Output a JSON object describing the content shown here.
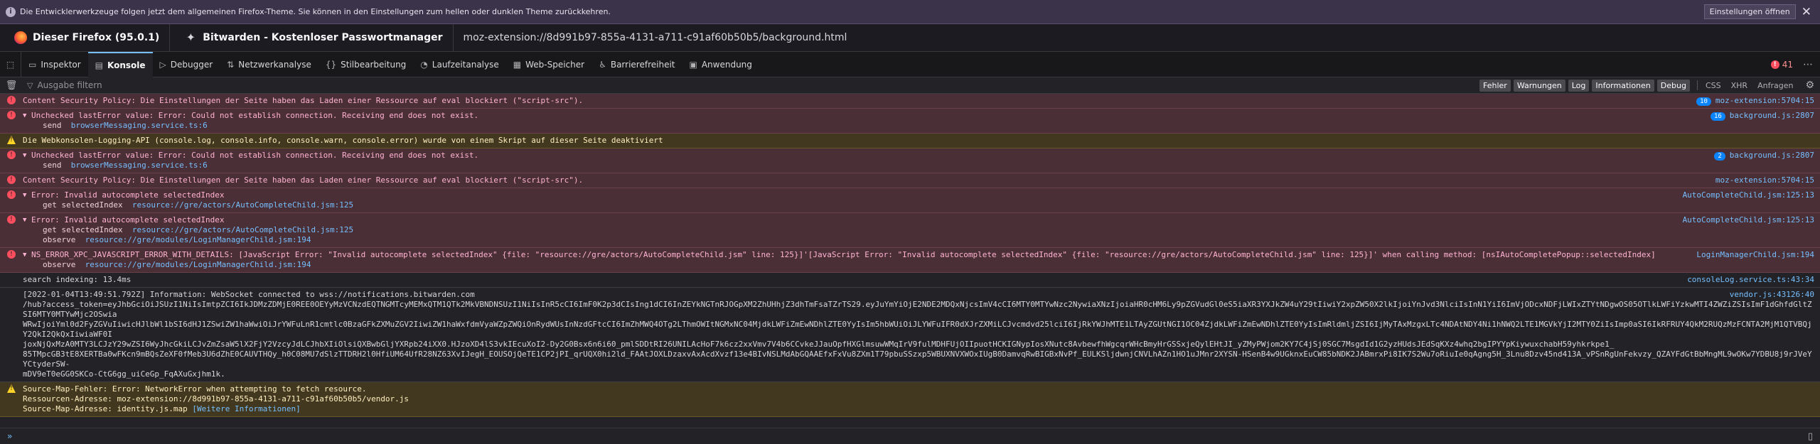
{
  "notification": {
    "text": "Die Entwicklerwerkzeuge folgen jetzt dem allgemeinen Firefox-Theme. Sie können in den Einstellungen zum hellen oder dunklen Theme zurückkehren.",
    "button": "Einstellungen öffnen",
    "close": "✕",
    "info_glyph": "i"
  },
  "tabs": {
    "firefox_title": "Dieser Firefox (95.0.1)",
    "bitwarden_title": "Bitwarden - Kostenloser Passwortmanager",
    "url": "moz-extension://8d991b97-855a-4131-a711-c91af60b50b5/background.html"
  },
  "toolbox": {
    "tools": [
      {
        "label": "Inspektor",
        "icon": "inspector-icon",
        "glyph": "▭"
      },
      {
        "label": "Konsole",
        "icon": "console-icon",
        "glyph": "▤",
        "selected": true
      },
      {
        "label": "Debugger",
        "icon": "debugger-icon",
        "glyph": "▷"
      },
      {
        "label": "Netzwerkanalyse",
        "icon": "network-icon",
        "glyph": "⇅"
      },
      {
        "label": "Stilbearbeitung",
        "icon": "style-editor-icon",
        "glyph": "{}"
      },
      {
        "label": "Laufzeitanalyse",
        "icon": "performance-icon",
        "glyph": "◔"
      },
      {
        "label": "Web-Speicher",
        "icon": "storage-icon",
        "glyph": "▦"
      },
      {
        "label": "Barrierefreiheit",
        "icon": "accessibility-icon",
        "glyph": "♿"
      },
      {
        "label": "Anwendung",
        "icon": "application-icon",
        "glyph": "▣"
      }
    ],
    "error_count": "41",
    "error_glyph": "!"
  },
  "filter": {
    "placeholder": "Ausgabe filtern",
    "levels": [
      "Fehler",
      "Warnungen",
      "Log",
      "Informationen",
      "Debug"
    ],
    "extra": [
      "CSS",
      "XHR",
      "Anfragen"
    ]
  },
  "messages": [
    {
      "level": "error",
      "arrow": false,
      "text": "Content Security Policy: Die Einstellungen der Seite haben das Laden einer Ressource auf eval blockiert (\"script-src\").",
      "count": "10",
      "source": "moz-extension:5704:15"
    },
    {
      "level": "error",
      "arrow": true,
      "text": "Unchecked lastError value: Error: Could not establish connection. Receiving end does not exist.",
      "count": "16",
      "source": "background.js:2807",
      "stack": [
        {
          "fn": "send",
          "loc": "browserMessaging.service.ts:6"
        }
      ]
    },
    {
      "level": "warn",
      "arrow": false,
      "text": "Die Webkonsolen-Logging-API (console.log, console.info, console.warn, console.error) wurde von einem Skript auf dieser Seite deaktiviert",
      "count": "",
      "source": ""
    },
    {
      "level": "error",
      "arrow": true,
      "text": "Unchecked lastError value: Error: Could not establish connection. Receiving end does not exist.",
      "count": "2",
      "source": "background.js:2807",
      "stack": [
        {
          "fn": "send",
          "loc": "browserMessaging.service.ts:6"
        }
      ]
    },
    {
      "level": "error",
      "arrow": false,
      "text": "Content Security Policy: Die Einstellungen der Seite haben das Laden einer Ressource auf eval blockiert (\"script-src\").",
      "count": "",
      "source": "moz-extension:5704:15"
    },
    {
      "level": "error",
      "arrow": true,
      "text": "Error: Invalid autocomplete selectedIndex",
      "count": "",
      "source": "AutoCompleteChild.jsm:125:13",
      "stack": [
        {
          "fn": "get selectedIndex",
          "loc": "resource://gre/actors/AutoCompleteChild.jsm:125"
        }
      ]
    },
    {
      "level": "error",
      "arrow": true,
      "text": "Error: Invalid autocomplete selectedIndex",
      "count": "",
      "source": "AutoCompleteChild.jsm:125:13",
      "stack": [
        {
          "fn": "get selectedIndex",
          "loc": "resource://gre/actors/AutoCompleteChild.jsm:125"
        },
        {
          "fn": "observe",
          "loc": "resource://gre/modules/LoginManagerChild.jsm:194"
        }
      ]
    },
    {
      "level": "error",
      "arrow": true,
      "text": "NS_ERROR_XPC_JAVASCRIPT_ERROR_WITH_DETAILS: [JavaScript Error: \"Invalid autocomplete selectedIndex\" {file: \"resource://gre/actors/AutoCompleteChild.jsm\" line: 125}]'[JavaScript Error: \"Invalid autocomplete selectedIndex\" {file: \"resource://gre/actors/AutoCompleteChild.jsm\" line: 125}]' when calling method: [nsIAutoCompletePopup::selectedIndex]",
      "count": "",
      "source": "LoginManagerChild.jsm:194",
      "stack": [
        {
          "fn": "observe",
          "loc": "resource://gre/modules/LoginManagerChild.jsm:194"
        }
      ]
    },
    {
      "level": "log",
      "arrow": false,
      "text": "search indexing: 13.4ms",
      "count": "",
      "source": "consoleLog.service.ts:43:34"
    },
    {
      "level": "log",
      "arrow": false,
      "text": "[2022-01-04T13:49:51.792Z] Information: WebSocket connected to wss://notifications.bitwarden.com\n/hub?access_token=eyJhbGciOiJSUzI1NiIsImtpZCI6IkJDMzZDMjE0REE0OEYyMzVCNzdEQTNGMTcyMEMxQTM1QTk2MkVBNDNSUzI1NiIsInR5cCI6ImF0K2p3dCIsIng1dCI6InZEYkNGTnRJOGpXM2ZhUHhjZ3dhTmFsaTZrTS29.eyJuYmYiOjE2NDE2MDQxNjcsImV4cCI6MTY0MTYwNzc2NywiaXNzIjoiaHR0cHM6Ly9pZGVudGl0eS5iaXR3YXJkZW4uY29tIiwiY2xpZW50X2lkIjoiYnJvd3NlciIsInN1YiI6ImVjODcxNDFjLWIxZTYtNDgwOS05OTlkLWFiYzkwMTI4ZWZiZSIsImF1dGhfdGltZSI6MTY0MTYwMjc2OSwia\nWRwIjoiYml0d2FyZGVuIiwicHJlbWl1bSI6dHJ1ZSwiZW1haWwiOiJrYWFuLnR1cmtlc0BzaGFkZXMuZGV2IiwiZW1haWxfdmVyaWZpZWQiOnRydWUsInNzdGFtcCI6ImZhMWQ4OTg2LThmOWItNGMxNC04MjdkLWFiZmEwNDhlZTE0YyIsIm5hbWUiOiJLYWFuIFR0dXJrZXMiLCJvcmdvd25lciI6IjRkYWJhMTE1LTAyZGUtNGI1OC04ZjdkLWFiZmEwNDhlZTE0YyIsImRldmljZSI6IjMyTAxMzgxLTc4NDAtNDY4Ni1hNWQ2LTE1MGVkYjI2MTY0ZiIsImp0aSI6IkRFRUY4QkM2RUQzMzFCNTA2MjM1QTVBQjY2QkI2QkQxIiwiaWF0I\njoxNjQxMzA0MTY3LCJzY29wZSI6WyJhcGkiLCJvZmZsaW5lX2FjY2VzcyJdLCJhbXIiOlsiQXBwbGljYXRpb24iXX0.HJzoXD4lS3vkIEcuXoI2-Dy2G0Bsx6n6i60_pmlSDDtRI26UNILAcHoF7k6cz2xxVmv7V4b6CCvkeJJauOpfHXGlmsuwWMqIrV9fulMDHFUjOIIpuotHCKIGNypIosXNutc8AvbewfhWgcqrWHcBmyHrGSSxjeQylEHtJI_yZMyPWjom2KY7C4jSj0SGC7MsgdId1G2yzHUdsJEdSqKXz4whq2bgIPYYpKiywuxchabH59yhkrkpe1_\n85TMpcGB3tE8XERTBa0wFKcn9mBQsZeXF0fMeb3U6dZhE0CAUVTHQy_h0C08MU7dSlzTTDRH2l0HfiUM64UfR28NZ63XvIJegH_EOUSOjQeTE1CP2jPI_qrUQX0hi2ld_FAAtJOXLDzaxvAxAcdXvzf13e4BIvNSLMdAbGQAAEfxFxVu8ZXm1T79pbuSSzxp5WBUXNVXWOxIUgB0DamvqRwBIGBxNvPf_EULKSljdwnjCNVLhAZn1HO1uJMnr2XYSN-HSenB4w9UGknxEuCW85bNDK2JABmrxPi8IK7S2Wu7oRiuIe0qAgng5H_3Lnu8Dzv45nd413A_vPSnRgUnFekvzy_QZAYFdGtBbMngML9wOKw7YDBU8j9rJVeYYCtyderSW-\nmDV9eT0eGG0SKCo-CtG6gg_uiCeGp_FqAXuGxjhm1k.",
      "count": "",
      "source": "vendor.js:43126:40"
    },
    {
      "level": "warn",
      "arrow": false,
      "text": "Source-Map-Fehler: Error: NetworkError when attempting to fetch resource.\nRessourcen-Adresse: moz-extension://8d991b97-855a-4131-a711-c91af60b50b5/vendor.js\nSource-Map-Adresse: identity.js.map",
      "link": "[Weitere Informationen]",
      "count": "",
      "source": ""
    }
  ],
  "input": {
    "prompt": "»",
    "split_icon": "split-console-icon"
  }
}
